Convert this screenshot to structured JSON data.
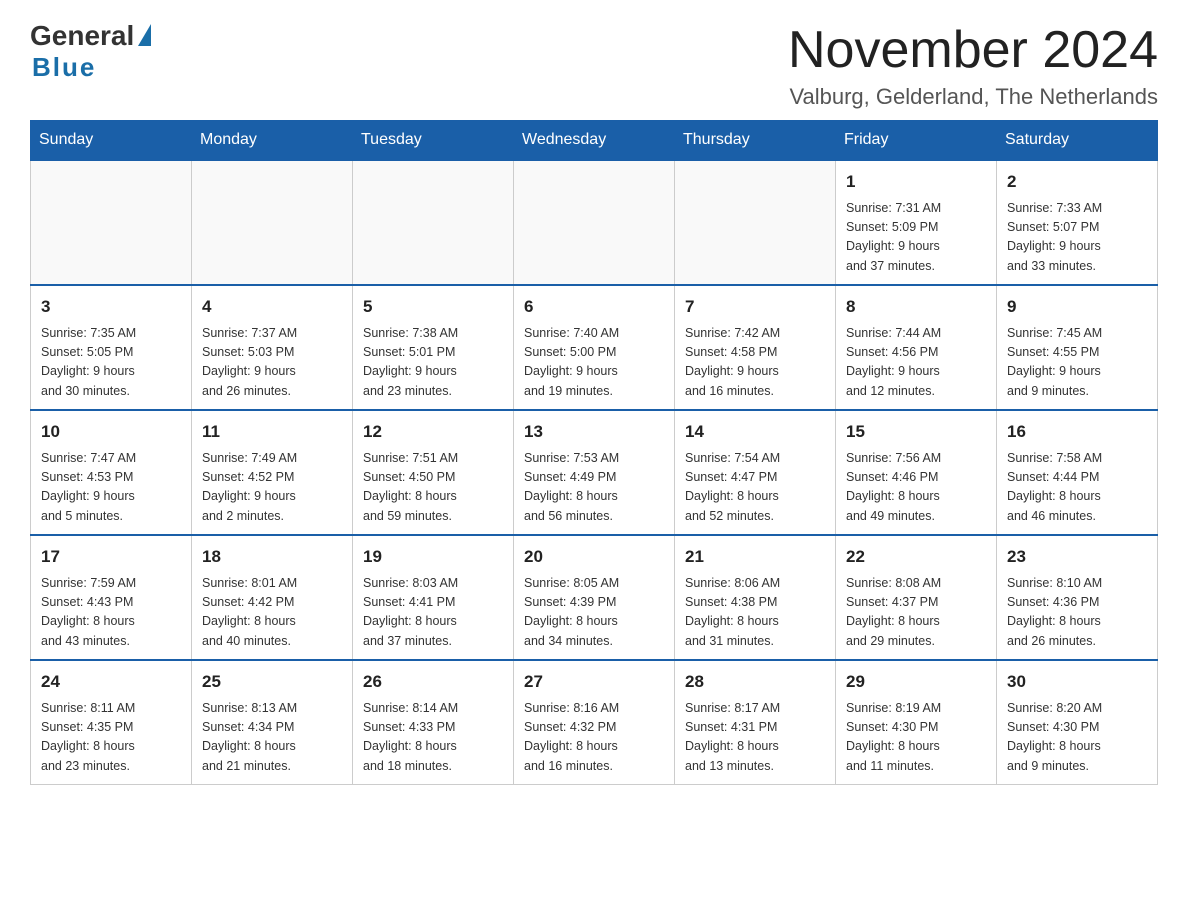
{
  "header": {
    "logo": {
      "general": "General",
      "blue": "Blue"
    },
    "title": "November 2024",
    "subtitle": "Valburg, Gelderland, The Netherlands"
  },
  "weekdays": [
    "Sunday",
    "Monday",
    "Tuesday",
    "Wednesday",
    "Thursday",
    "Friday",
    "Saturday"
  ],
  "weeks": [
    [
      {
        "day": "",
        "info": ""
      },
      {
        "day": "",
        "info": ""
      },
      {
        "day": "",
        "info": ""
      },
      {
        "day": "",
        "info": ""
      },
      {
        "day": "",
        "info": ""
      },
      {
        "day": "1",
        "info": "Sunrise: 7:31 AM\nSunset: 5:09 PM\nDaylight: 9 hours\nand 37 minutes."
      },
      {
        "day": "2",
        "info": "Sunrise: 7:33 AM\nSunset: 5:07 PM\nDaylight: 9 hours\nand 33 minutes."
      }
    ],
    [
      {
        "day": "3",
        "info": "Sunrise: 7:35 AM\nSunset: 5:05 PM\nDaylight: 9 hours\nand 30 minutes."
      },
      {
        "day": "4",
        "info": "Sunrise: 7:37 AM\nSunset: 5:03 PM\nDaylight: 9 hours\nand 26 minutes."
      },
      {
        "day": "5",
        "info": "Sunrise: 7:38 AM\nSunset: 5:01 PM\nDaylight: 9 hours\nand 23 minutes."
      },
      {
        "day": "6",
        "info": "Sunrise: 7:40 AM\nSunset: 5:00 PM\nDaylight: 9 hours\nand 19 minutes."
      },
      {
        "day": "7",
        "info": "Sunrise: 7:42 AM\nSunset: 4:58 PM\nDaylight: 9 hours\nand 16 minutes."
      },
      {
        "day": "8",
        "info": "Sunrise: 7:44 AM\nSunset: 4:56 PM\nDaylight: 9 hours\nand 12 minutes."
      },
      {
        "day": "9",
        "info": "Sunrise: 7:45 AM\nSunset: 4:55 PM\nDaylight: 9 hours\nand 9 minutes."
      }
    ],
    [
      {
        "day": "10",
        "info": "Sunrise: 7:47 AM\nSunset: 4:53 PM\nDaylight: 9 hours\nand 5 minutes."
      },
      {
        "day": "11",
        "info": "Sunrise: 7:49 AM\nSunset: 4:52 PM\nDaylight: 9 hours\nand 2 minutes."
      },
      {
        "day": "12",
        "info": "Sunrise: 7:51 AM\nSunset: 4:50 PM\nDaylight: 8 hours\nand 59 minutes."
      },
      {
        "day": "13",
        "info": "Sunrise: 7:53 AM\nSunset: 4:49 PM\nDaylight: 8 hours\nand 56 minutes."
      },
      {
        "day": "14",
        "info": "Sunrise: 7:54 AM\nSunset: 4:47 PM\nDaylight: 8 hours\nand 52 minutes."
      },
      {
        "day": "15",
        "info": "Sunrise: 7:56 AM\nSunset: 4:46 PM\nDaylight: 8 hours\nand 49 minutes."
      },
      {
        "day": "16",
        "info": "Sunrise: 7:58 AM\nSunset: 4:44 PM\nDaylight: 8 hours\nand 46 minutes."
      }
    ],
    [
      {
        "day": "17",
        "info": "Sunrise: 7:59 AM\nSunset: 4:43 PM\nDaylight: 8 hours\nand 43 minutes."
      },
      {
        "day": "18",
        "info": "Sunrise: 8:01 AM\nSunset: 4:42 PM\nDaylight: 8 hours\nand 40 minutes."
      },
      {
        "day": "19",
        "info": "Sunrise: 8:03 AM\nSunset: 4:41 PM\nDaylight: 8 hours\nand 37 minutes."
      },
      {
        "day": "20",
        "info": "Sunrise: 8:05 AM\nSunset: 4:39 PM\nDaylight: 8 hours\nand 34 minutes."
      },
      {
        "day": "21",
        "info": "Sunrise: 8:06 AM\nSunset: 4:38 PM\nDaylight: 8 hours\nand 31 minutes."
      },
      {
        "day": "22",
        "info": "Sunrise: 8:08 AM\nSunset: 4:37 PM\nDaylight: 8 hours\nand 29 minutes."
      },
      {
        "day": "23",
        "info": "Sunrise: 8:10 AM\nSunset: 4:36 PM\nDaylight: 8 hours\nand 26 minutes."
      }
    ],
    [
      {
        "day": "24",
        "info": "Sunrise: 8:11 AM\nSunset: 4:35 PM\nDaylight: 8 hours\nand 23 minutes."
      },
      {
        "day": "25",
        "info": "Sunrise: 8:13 AM\nSunset: 4:34 PM\nDaylight: 8 hours\nand 21 minutes."
      },
      {
        "day": "26",
        "info": "Sunrise: 8:14 AM\nSunset: 4:33 PM\nDaylight: 8 hours\nand 18 minutes."
      },
      {
        "day": "27",
        "info": "Sunrise: 8:16 AM\nSunset: 4:32 PM\nDaylight: 8 hours\nand 16 minutes."
      },
      {
        "day": "28",
        "info": "Sunrise: 8:17 AM\nSunset: 4:31 PM\nDaylight: 8 hours\nand 13 minutes."
      },
      {
        "day": "29",
        "info": "Sunrise: 8:19 AM\nSunset: 4:30 PM\nDaylight: 8 hours\nand 11 minutes."
      },
      {
        "day": "30",
        "info": "Sunrise: 8:20 AM\nSunset: 4:30 PM\nDaylight: 8 hours\nand 9 minutes."
      }
    ]
  ]
}
